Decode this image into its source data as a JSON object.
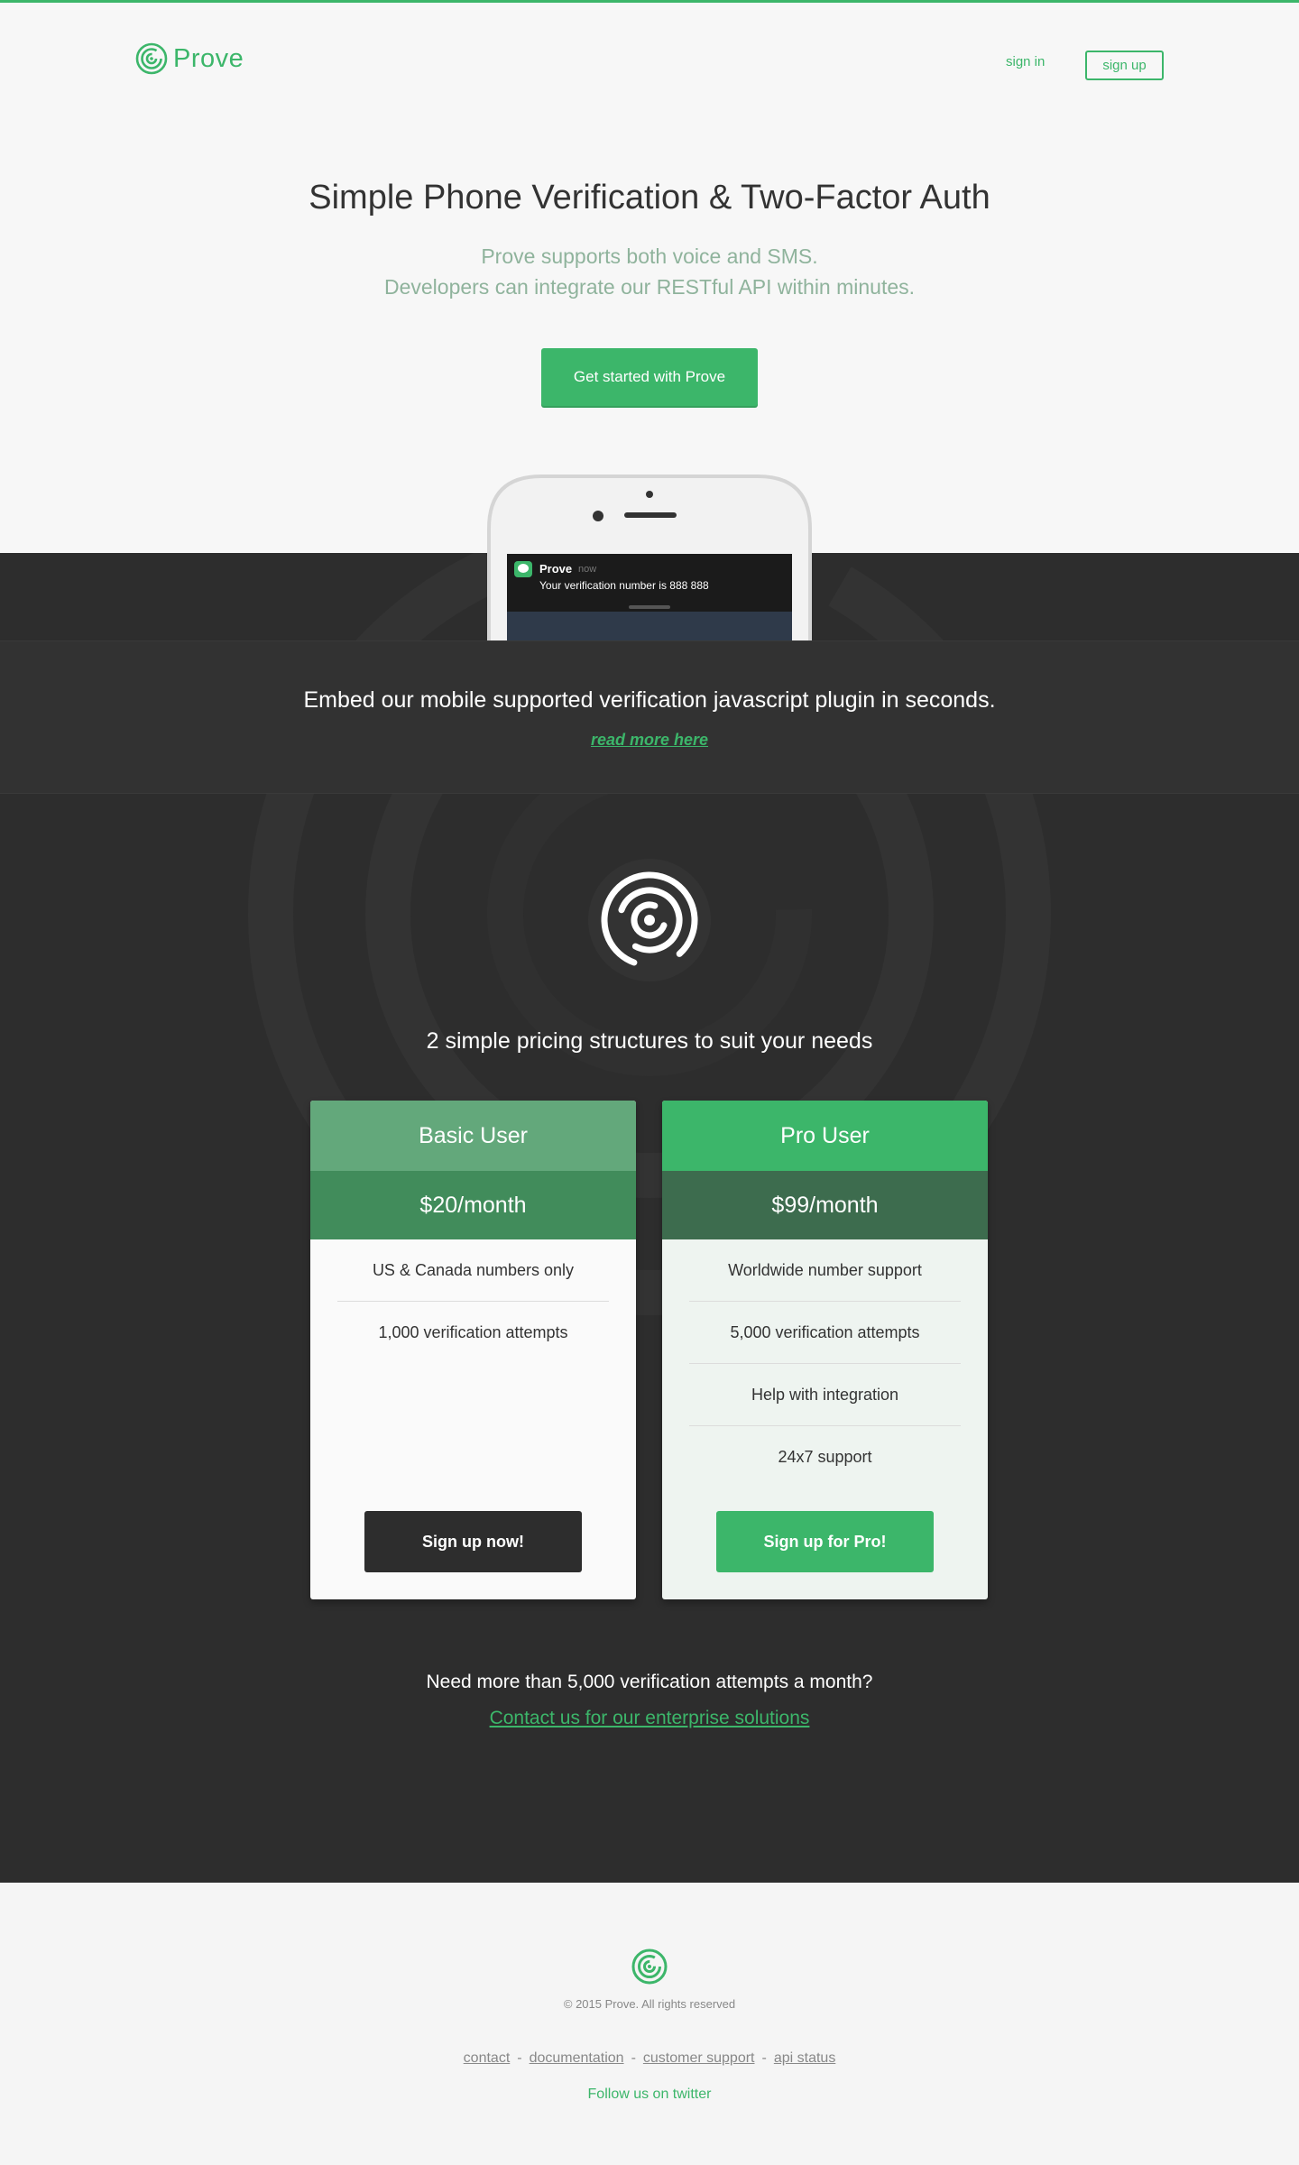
{
  "brand": {
    "name": "Prove",
    "color": "#3cb66a"
  },
  "nav": {
    "signin": "sign in",
    "signup": "sign up"
  },
  "hero": {
    "title": "Simple Phone Verification & Two-Factor Auth",
    "subtitle_line1": "Prove supports both voice and SMS.",
    "subtitle_line2": "Developers can integrate our RESTful API within minutes.",
    "cta": "Get started with Prove"
  },
  "phone": {
    "notification_app": "Prove",
    "notification_time": "now",
    "notification_message": "Your verification number is 888 888"
  },
  "embed": {
    "text": "Embed our mobile supported verification javascript plugin in seconds.",
    "link": "read more here"
  },
  "pricing": {
    "title": "2 simple pricing structures to suit your needs",
    "plans": [
      {
        "name": "Basic User",
        "price": "$20/month",
        "features": [
          "US & Canada numbers only",
          "1,000 verification attempts"
        ],
        "button": "Sign up now!"
      },
      {
        "name": "Pro User",
        "price": "$99/month",
        "features": [
          "Worldwide number support",
          "5,000 verification attempts",
          "Help with integration",
          "24x7 support"
        ],
        "button": "Sign up for Pro!"
      }
    ]
  },
  "enterprise": {
    "text": "Need more than 5,000 verification attempts a month?",
    "link": "Contact us for our enterprise solutions"
  },
  "footer": {
    "copyright": "© 2015 Prove. All rights reserved",
    "links": [
      "contact",
      "documentation",
      "customer support",
      "api status"
    ],
    "separator": "-",
    "twitter": "Follow us on twitter"
  },
  "icons": {
    "logo": "prove-rings-logo-icon",
    "message": "message-bubble-icon"
  }
}
